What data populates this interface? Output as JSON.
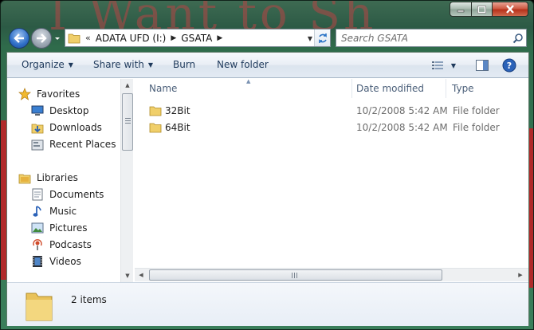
{
  "window": {
    "background_text": "I Want to Sh"
  },
  "caption": {
    "minimize": "minimize",
    "maximize": "maximize",
    "close": "close"
  },
  "address": {
    "overflow": "«",
    "segments": [
      "ADATA UFD (I:)",
      "GSATA"
    ]
  },
  "search": {
    "placeholder": "Search GSATA"
  },
  "toolbar": {
    "organize": "Organize",
    "share_with": "Share with",
    "burn": "Burn",
    "new_folder": "New folder"
  },
  "nav": {
    "favorites": {
      "label": "Favorites",
      "items": [
        {
          "label": "Desktop",
          "icon": "desktop-icon"
        },
        {
          "label": "Downloads",
          "icon": "downloads-icon"
        },
        {
          "label": "Recent Places",
          "icon": "recent-places-icon"
        }
      ]
    },
    "libraries": {
      "label": "Libraries",
      "items": [
        {
          "label": "Documents",
          "icon": "documents-icon"
        },
        {
          "label": "Music",
          "icon": "music-icon"
        },
        {
          "label": "Pictures",
          "icon": "pictures-icon"
        },
        {
          "label": "Podcasts",
          "icon": "podcasts-icon"
        },
        {
          "label": "Videos",
          "icon": "videos-icon"
        }
      ]
    }
  },
  "columns": {
    "name": "Name",
    "date_modified": "Date modified",
    "type": "Type"
  },
  "files": [
    {
      "name": "32Bit",
      "date": "10/2/2008 5:42 AM",
      "type": "File folder"
    },
    {
      "name": "64Bit",
      "date": "10/2/2008 5:42 AM",
      "type": "File folder"
    }
  ],
  "details": {
    "count": "2 items"
  },
  "colors": {
    "accent": "#1e395b",
    "folder": "#f0cf6a",
    "close_red": "#c43d22"
  }
}
